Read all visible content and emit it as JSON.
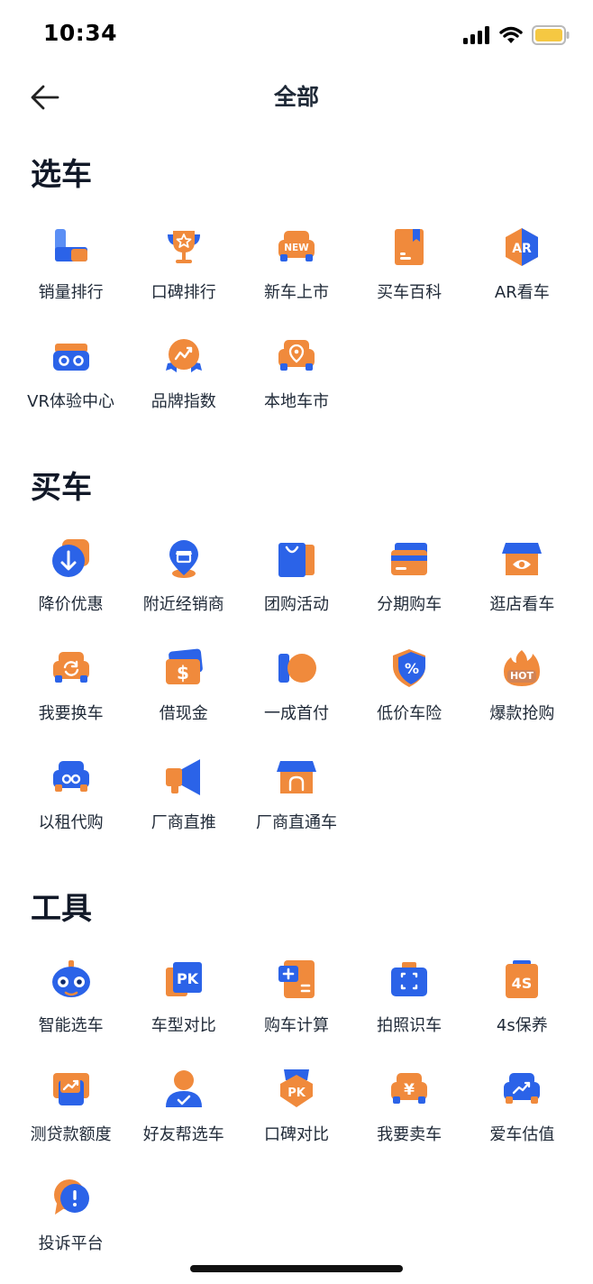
{
  "status": {
    "time": "10:34"
  },
  "header": {
    "title": "全部"
  },
  "colors": {
    "blue": "#2b63e8",
    "orange": "#f08a3c",
    "text": "#1f2937"
  },
  "sections": [
    {
      "title": "选车",
      "items": [
        {
          "label": "销量排行",
          "icon": "sales-rank-icon"
        },
        {
          "label": "口碑排行",
          "icon": "trophy-icon"
        },
        {
          "label": "新车上市",
          "icon": "new-car-icon"
        },
        {
          "label": "买车百科",
          "icon": "encyclopedia-book-icon"
        },
        {
          "label": "AR看车",
          "icon": "ar-cube-icon"
        },
        {
          "label": "VR体验中心",
          "icon": "vr-goggles-icon"
        },
        {
          "label": "品牌指数",
          "icon": "brand-index-medal-icon"
        },
        {
          "label": "本地车市",
          "icon": "local-market-car-pin-icon"
        }
      ]
    },
    {
      "title": "买车",
      "items": [
        {
          "label": "降价优惠",
          "icon": "price-drop-icon"
        },
        {
          "label": "附近经销商",
          "icon": "nearby-dealer-pin-icon"
        },
        {
          "label": "团购活动",
          "icon": "shopping-bag-icon"
        },
        {
          "label": "分期购车",
          "icon": "credit-card-icon"
        },
        {
          "label": "逛店看车",
          "icon": "storefront-eye-icon"
        },
        {
          "label": "我要换车",
          "icon": "car-swap-icon"
        },
        {
          "label": "借现金",
          "icon": "cash-dollar-icon"
        },
        {
          "label": "一成首付",
          "icon": "down-payment-icon"
        },
        {
          "label": "低价车险",
          "icon": "insurance-shield-icon"
        },
        {
          "label": "爆款抢购",
          "icon": "hot-flame-icon"
        },
        {
          "label": "以租代购",
          "icon": "lease-car-key-icon"
        },
        {
          "label": "厂商直推",
          "icon": "megaphone-icon"
        },
        {
          "label": "厂商直通车",
          "icon": "direct-store-icon"
        }
      ]
    },
    {
      "title": "工具",
      "items": [
        {
          "label": "智能选车",
          "icon": "robot-icon"
        },
        {
          "label": "车型对比",
          "icon": "pk-compare-icon"
        },
        {
          "label": "购车计算",
          "icon": "calculator-icon"
        },
        {
          "label": "拍照识车",
          "icon": "camera-scan-icon"
        },
        {
          "label": "4s保养",
          "icon": "4s-maintenance-icon"
        },
        {
          "label": "测贷款额度",
          "icon": "loan-chart-icon"
        },
        {
          "label": "好友帮选车",
          "icon": "friend-help-icon"
        },
        {
          "label": "口碑对比",
          "icon": "pk-badge-icon"
        },
        {
          "label": "我要卖车",
          "icon": "sell-car-yen-icon"
        },
        {
          "label": "爱车估值",
          "icon": "car-valuation-icon"
        },
        {
          "label": "投诉平台",
          "icon": "complaint-bubble-icon"
        }
      ]
    }
  ]
}
